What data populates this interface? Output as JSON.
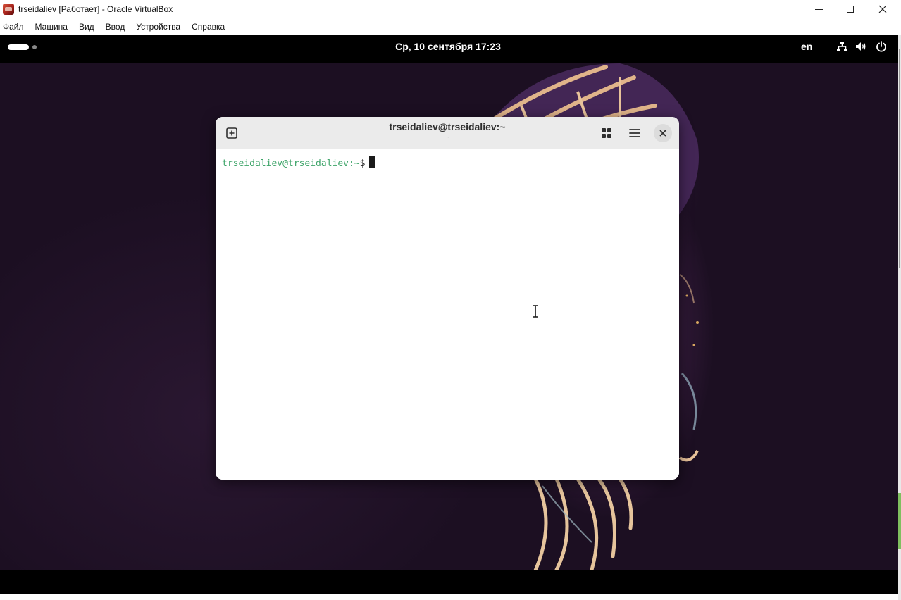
{
  "host_window": {
    "title": "trseidaliev [Работает] - Oracle VirtualBox",
    "menu": [
      "Файл",
      "Машина",
      "Вид",
      "Ввод",
      "Устройства",
      "Справка"
    ]
  },
  "guest_topbar": {
    "clock": "Ср, 10 сентября  17:23",
    "keyboard_layout": "en"
  },
  "terminal": {
    "title": "trseidaliev@trseidaliev:~",
    "subtitle": "~",
    "prompt_user_host": "trseidaliev@trseidaliev",
    "prompt_path": ":~",
    "prompt_symbol": "$"
  },
  "colors": {
    "prompt_green": "#3fa56a",
    "topbar": "#000000",
    "wallpaper": "#1f1126"
  }
}
